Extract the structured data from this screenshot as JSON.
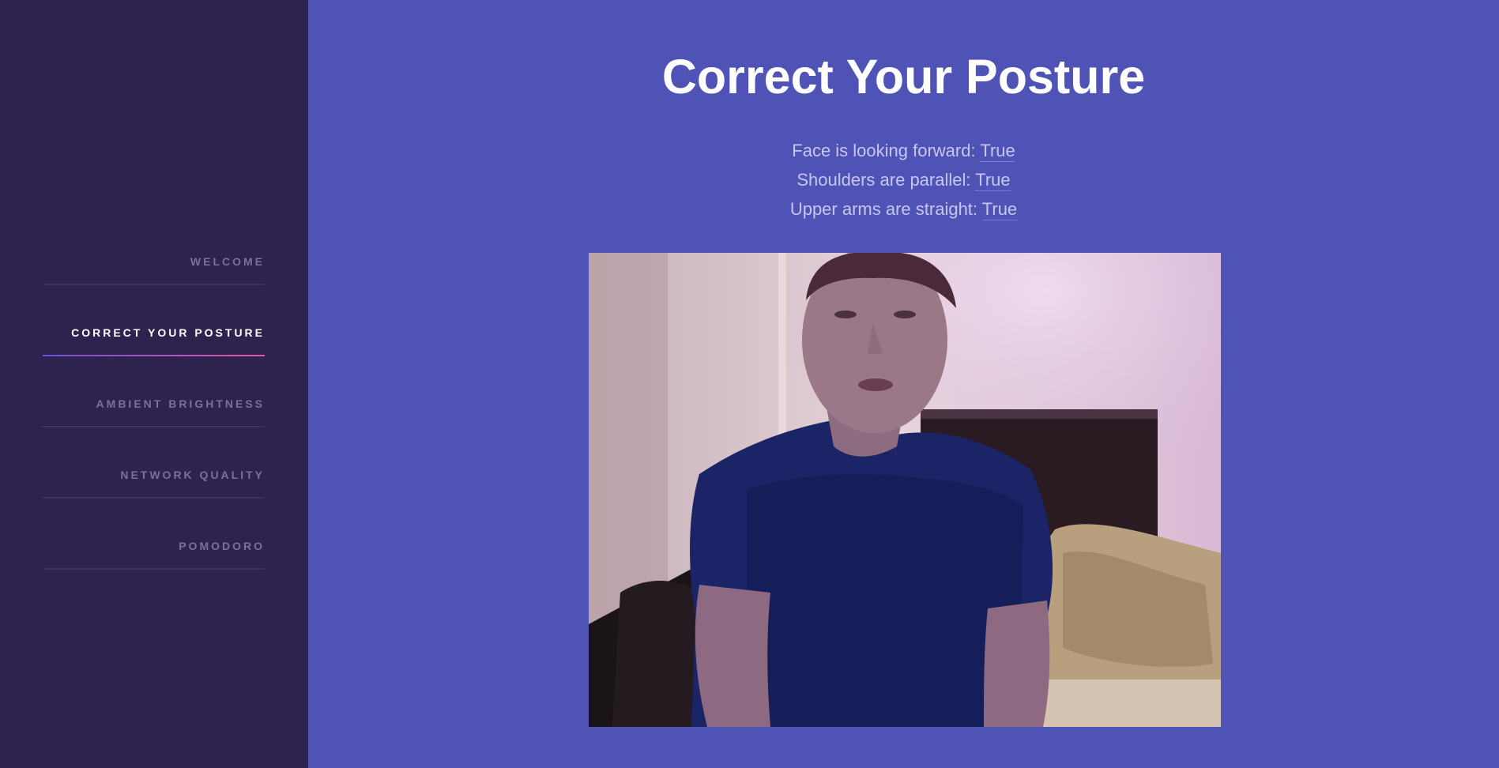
{
  "sidebar": {
    "items": [
      {
        "label": "WELCOME",
        "active": false
      },
      {
        "label": "CORRECT YOUR POSTURE",
        "active": true
      },
      {
        "label": "AMBIENT BRIGHTNESS",
        "active": false
      },
      {
        "label": "NETWORK QUALITY",
        "active": false
      },
      {
        "label": "POMODORO",
        "active": false
      }
    ]
  },
  "main": {
    "title": "Correct Your Posture",
    "statuses": [
      {
        "label": "Face is looking forward:",
        "value": "True"
      },
      {
        "label": "Shoulders are parallel:",
        "value": "True"
      },
      {
        "label": "Upper arms are straight:",
        "value": "True"
      }
    ],
    "camera_feed": {
      "description_icon": "webcam-feed"
    }
  },
  "colors": {
    "sidebar_bg": "#2e224f",
    "main_bg": "#5053b6",
    "active_gradient_start": "#6c4fd6",
    "active_gradient_end": "#e25aa6",
    "inactive_label": "#7d6f9c"
  }
}
